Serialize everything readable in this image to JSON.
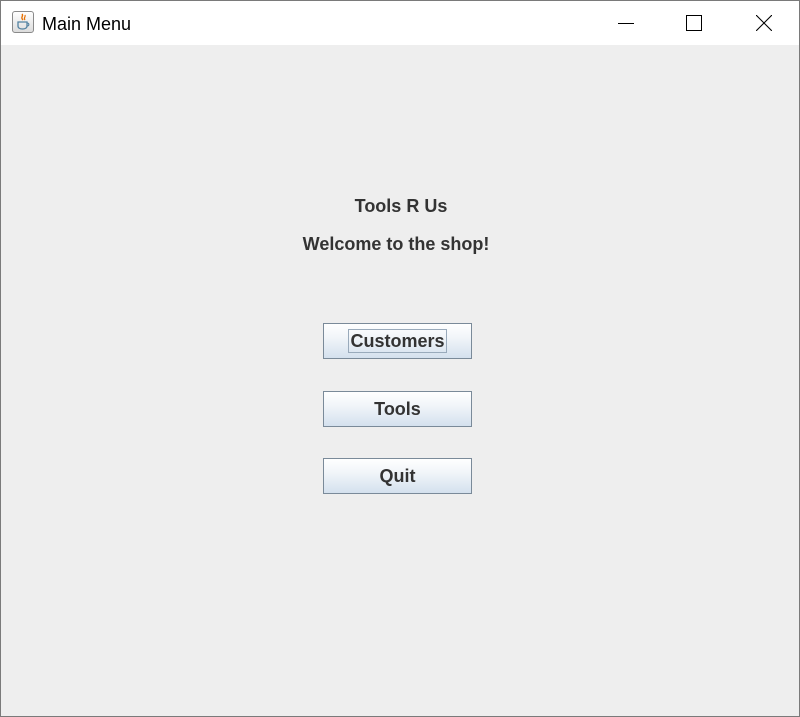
{
  "window": {
    "title": "Main Menu",
    "icon": "java-coffee-cup-icon"
  },
  "header": {
    "shop_name": "Tools R Us",
    "welcome": "Welcome to the shop!"
  },
  "menu": {
    "customers_label": "Customers",
    "tools_label": "Tools",
    "quit_label": "Quit",
    "focused": "Customers"
  },
  "colors": {
    "background": "#eeeeee",
    "titlebar": "#ffffff",
    "text": "#333333",
    "button_border": "#7a8a99"
  }
}
